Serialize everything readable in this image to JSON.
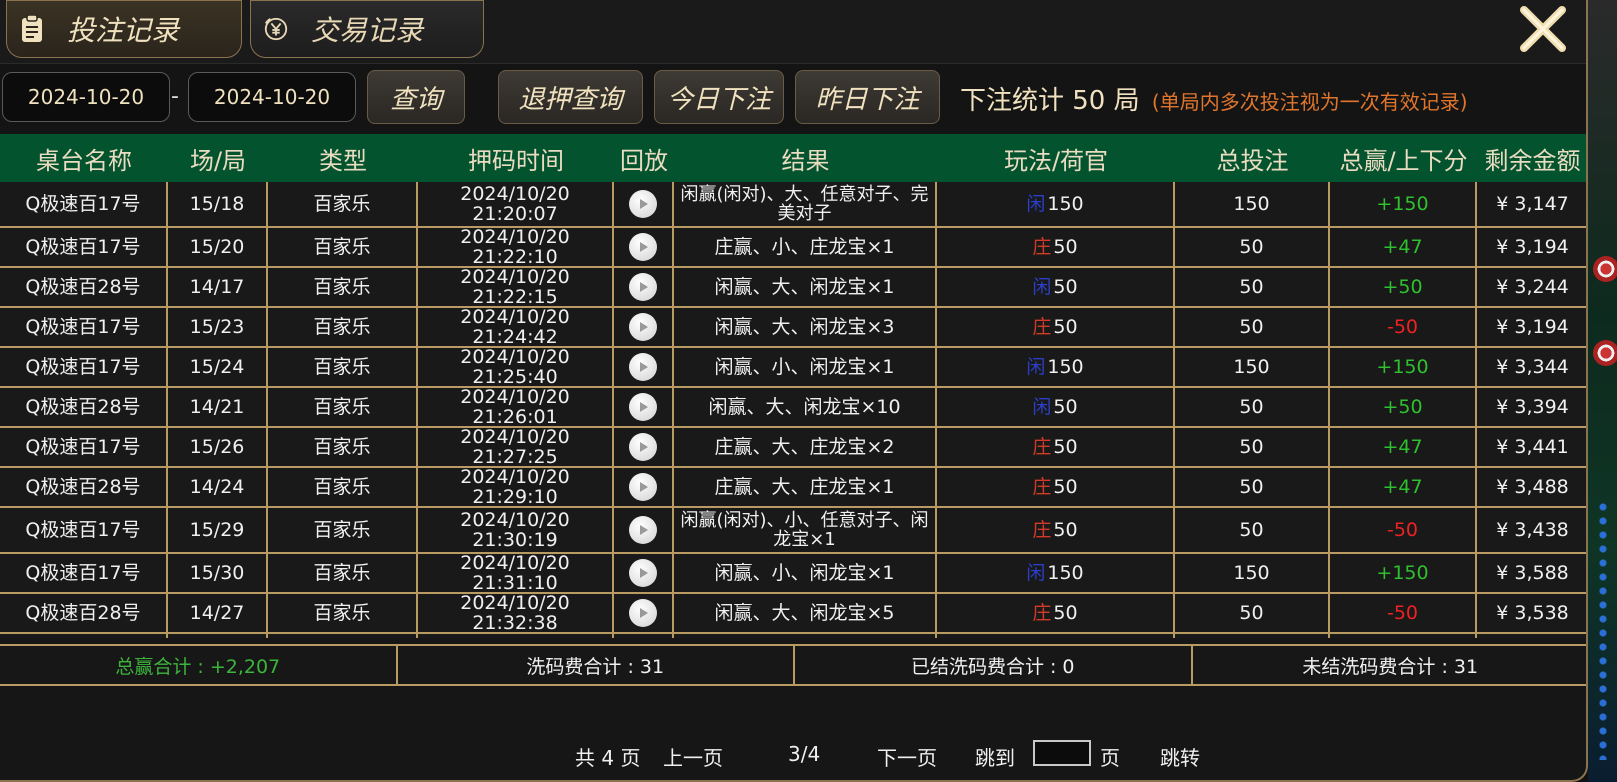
{
  "tabs": [
    {
      "label": "投注记录",
      "icon": "clipboard-icon",
      "active": true
    },
    {
      "label": "交易记录",
      "icon": "yen-coin-icon",
      "active": false
    }
  ],
  "filter": {
    "start_date": "2024-10-20",
    "separator": "-",
    "end_date": "2024-10-20",
    "query_label": "查询",
    "refund_query_label": "退押查询",
    "today_label": "今日下注",
    "yesterday_label": "昨日下注",
    "stat_text": "下注统计 50 局",
    "stat_note": "(单局内多次投注视为一次有效记录)"
  },
  "columns": [
    "桌台名称",
    "场/局",
    "类型",
    "押码时间",
    "回放",
    "结果",
    "玩法/荷官",
    "总投注",
    "总赢/上下分",
    "剩余金额"
  ],
  "rows": [
    {
      "table": "Q极速百17号",
      "round": "15/18",
      "type": "百家乐",
      "time": "2024/10/20 21:20:07",
      "result": "闲赢(闲对)、大、任意对子、完美对子",
      "side": "闲",
      "bet": "150",
      "total": "150",
      "win": "+150",
      "balance": "¥ 3,147"
    },
    {
      "table": "Q极速百17号",
      "round": "15/20",
      "type": "百家乐",
      "time": "2024/10/20 21:22:10",
      "result": "庄赢、小、庄龙宝×1",
      "side": "庄",
      "bet": "50",
      "total": "50",
      "win": "+47",
      "balance": "¥ 3,194"
    },
    {
      "table": "Q极速百28号",
      "round": "14/17",
      "type": "百家乐",
      "time": "2024/10/20 21:22:15",
      "result": "闲赢、大、闲龙宝×1",
      "side": "闲",
      "bet": "50",
      "total": "50",
      "win": "+50",
      "balance": "¥ 3,244"
    },
    {
      "table": "Q极速百17号",
      "round": "15/23",
      "type": "百家乐",
      "time": "2024/10/20 21:24:42",
      "result": "闲赢、大、闲龙宝×3",
      "side": "庄",
      "bet": "50",
      "total": "50",
      "win": "-50",
      "balance": "¥ 3,194"
    },
    {
      "table": "Q极速百17号",
      "round": "15/24",
      "type": "百家乐",
      "time": "2024/10/20 21:25:40",
      "result": "闲赢、小、闲龙宝×1",
      "side": "闲",
      "bet": "150",
      "total": "150",
      "win": "+150",
      "balance": "¥ 3,344"
    },
    {
      "table": "Q极速百28号",
      "round": "14/21",
      "type": "百家乐",
      "time": "2024/10/20 21:26:01",
      "result": "闲赢、大、闲龙宝×10",
      "side": "闲",
      "bet": "50",
      "total": "50",
      "win": "+50",
      "balance": "¥ 3,394"
    },
    {
      "table": "Q极速百17号",
      "round": "15/26",
      "type": "百家乐",
      "time": "2024/10/20 21:27:25",
      "result": "庄赢、大、庄龙宝×2",
      "side": "庄",
      "bet": "50",
      "total": "50",
      "win": "+47",
      "balance": "¥ 3,441"
    },
    {
      "table": "Q极速百28号",
      "round": "14/24",
      "type": "百家乐",
      "time": "2024/10/20 21:29:10",
      "result": "庄赢、大、庄龙宝×1",
      "side": "庄",
      "bet": "50",
      "total": "50",
      "win": "+47",
      "balance": "¥ 3,488"
    },
    {
      "table": "Q极速百17号",
      "round": "15/29",
      "type": "百家乐",
      "time": "2024/10/20 21:30:19",
      "result": "闲赢(闲对)、小、任意对子、闲龙宝×1",
      "side": "庄",
      "bet": "50",
      "total": "50",
      "win": "-50",
      "balance": "¥ 3,438"
    },
    {
      "table": "Q极速百17号",
      "round": "15/30",
      "type": "百家乐",
      "time": "2024/10/20 21:31:10",
      "result": "闲赢、小、闲龙宝×1",
      "side": "闲",
      "bet": "150",
      "total": "150",
      "win": "+150",
      "balance": "¥ 3,588"
    },
    {
      "table": "Q极速百28号",
      "round": "14/27",
      "type": "百家乐",
      "time": "2024/10/20 21:32:38",
      "result": "闲赢、大、闲龙宝×5",
      "side": "庄",
      "bet": "50",
      "total": "50",
      "win": "-50",
      "balance": "¥ 3,538"
    }
  ],
  "summary": {
    "total_win": "总赢合计 : +2,207",
    "rebate_total": "洗码费合计 : 31",
    "settled_rebate": "已结洗码费合计 : 0",
    "unsettled_rebate": "未结洗码费合计 : 31"
  },
  "pager": {
    "total_pages": "共 4 页",
    "prev": "上一页",
    "current": "3/4",
    "next": "下一页",
    "jump_to": "跳到",
    "page_unit": "页",
    "go": "跳转"
  },
  "colors": {
    "header_green": "#04532f",
    "grid_gold": "#b99a63",
    "win_green": "#2fc02f",
    "loss_red": "#e22",
    "xian_blue": "#2b3fc8",
    "zhuang_red": "#d23a2a",
    "note_orange": "#e0752c"
  }
}
